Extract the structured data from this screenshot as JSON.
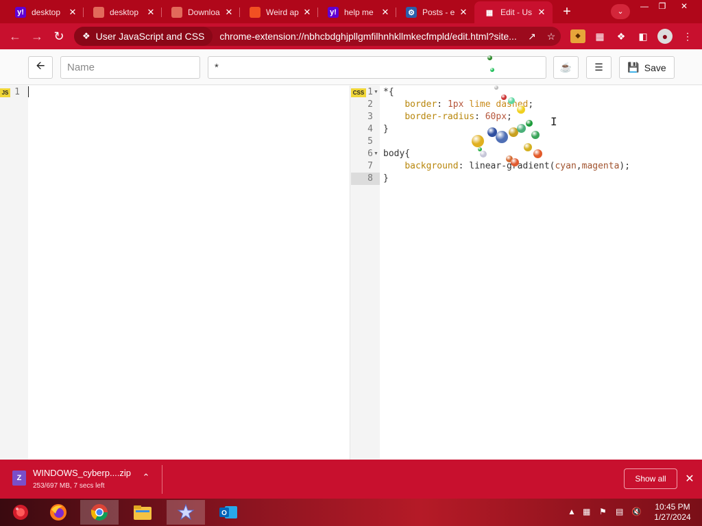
{
  "browser": {
    "tabs": [
      {
        "title": "desktop",
        "favicon": "yahoo-icon",
        "color": "#6001d2",
        "glyph": "y!"
      },
      {
        "title": "desktop",
        "favicon": "generic-site-icon",
        "color": "#e26a5b",
        "glyph": ""
      },
      {
        "title": "Downloa",
        "favicon": "generic-site-icon",
        "color": "#e26a5b",
        "glyph": ""
      },
      {
        "title": "Weird ap",
        "favicon": "microsoft-icon",
        "color": "#f25022",
        "glyph": ""
      },
      {
        "title": "help me",
        "favicon": "yahoo-icon",
        "color": "#6001d2",
        "glyph": "y!"
      },
      {
        "title": "Posts - e",
        "favicon": "gear-site-icon",
        "color": "#2b5fab",
        "glyph": "⚙"
      },
      {
        "title": "Edit - Us",
        "favicon": "edit-page-icon",
        "color": "#ffffff",
        "glyph": "▦",
        "active": true
      }
    ],
    "omnibox": {
      "extension_label": "User JavaScript and CSS",
      "url": "chrome-extension://nbhcbdghjpllgmfilhnhkllmkecfmpld/edit.html?site..."
    }
  },
  "editor": {
    "name_placeholder": "Name",
    "match_value": "*",
    "save_label": "Save",
    "js_badge": "JS",
    "css_badge": "CSS",
    "js_lines": [
      "1"
    ],
    "css_code": [
      {
        "n": "1",
        "fold": true,
        "parts": [
          [
            "c-txt",
            "*{"
          ]
        ]
      },
      {
        "n": "2",
        "parts": [
          [
            "c-txt",
            "    "
          ],
          [
            "c-prop",
            "border"
          ],
          [
            "c-txt",
            ": "
          ],
          [
            "c-num",
            "1px"
          ],
          [
            "c-txt",
            " "
          ],
          [
            "c-kw",
            "lime"
          ],
          [
            "c-txt",
            " "
          ],
          [
            "c-kw",
            "dashed"
          ],
          [
            "c-txt",
            ";"
          ]
        ]
      },
      {
        "n": "3",
        "parts": [
          [
            "c-txt",
            "    "
          ],
          [
            "c-prop",
            "border-radius"
          ],
          [
            "c-txt",
            ": "
          ],
          [
            "c-num",
            "60px"
          ],
          [
            "c-txt",
            ";"
          ]
        ]
      },
      {
        "n": "4",
        "parts": [
          [
            "c-txt",
            "}"
          ]
        ]
      },
      {
        "n": "5",
        "parts": [
          [
            "c-txt",
            ""
          ]
        ]
      },
      {
        "n": "6",
        "fold": true,
        "parts": [
          [
            "c-txt",
            "body{"
          ]
        ]
      },
      {
        "n": "7",
        "parts": [
          [
            "c-txt",
            "    "
          ],
          [
            "c-prop",
            "background"
          ],
          [
            "c-txt",
            ": linear-gradient("
          ],
          [
            "c-str",
            "cyan"
          ],
          [
            "c-txt",
            ","
          ],
          [
            "c-str",
            "magenta"
          ],
          [
            "c-txt",
            ");"
          ]
        ]
      },
      {
        "n": "8",
        "parts": [
          [
            "c-txt",
            "}"
          ]
        ]
      }
    ]
  },
  "download": {
    "filename": "WINDOWS_cyberp....zip",
    "status": "253/697 MB, 7 secs left",
    "show_all": "Show all"
  },
  "taskbar": {
    "time": "10:45 PM",
    "date": "1/27/2024"
  }
}
